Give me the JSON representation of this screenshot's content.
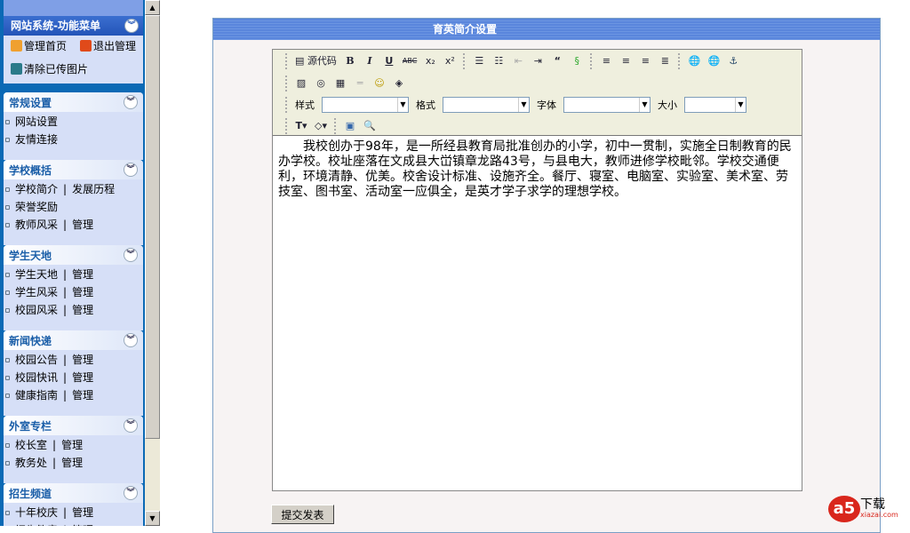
{
  "sidebar": {
    "title": "网站系统-功能菜单",
    "quick_links": [
      "管理首页",
      "退出管理",
      "清除已传图片"
    ],
    "sections": [
      {
        "title": "常规设置",
        "items": [
          [
            "网站设置"
          ],
          [
            "友情连接"
          ]
        ]
      },
      {
        "title": "学校概括",
        "items": [
          [
            "学校简介",
            "发展历程"
          ],
          [
            "荣誉奖励"
          ],
          [
            "教师风采",
            "管理"
          ]
        ]
      },
      {
        "title": "学生天地",
        "items": [
          [
            "学生天地",
            "管理"
          ],
          [
            "学生风采",
            "管理"
          ],
          [
            "校园风采",
            "管理"
          ]
        ]
      },
      {
        "title": "新闻快递",
        "items": [
          [
            "校园公告",
            "管理"
          ],
          [
            "校园快讯",
            "管理"
          ],
          [
            "健康指南",
            "管理"
          ]
        ]
      },
      {
        "title": "外室专栏",
        "items": [
          [
            "校长室",
            "管理"
          ],
          [
            "教务处",
            "管理"
          ]
        ]
      },
      {
        "title": "招生频道",
        "items": [
          [
            "十年校庆",
            "管理"
          ],
          [
            "招生简章",
            "管理"
          ]
        ]
      }
    ]
  },
  "panel": {
    "title": "育英简介设置"
  },
  "editor": {
    "source_label": "源代码",
    "style_label": "样式",
    "format_label": "格式",
    "font_label": "字体",
    "size_label": "大小",
    "content": "　　我校创办于98年，是一所经县教育局批准创办的小学，初中一贯制，实施全日制教育的民办学校。校址座落在文成县大峃镇章龙路43号，与县电大，教师进修学校毗邻。学校交通便利，环境清静、优美。校舍设计标准、设施齐全。餐厅、寝室、电脑室、实验室、美术室、劳技室、图书室、活动室一应俱全，是英才学子求学的理想学校。"
  },
  "submit_label": "提交发表",
  "watermark": {
    "brand": "下载",
    "site": "xiazai.com"
  }
}
